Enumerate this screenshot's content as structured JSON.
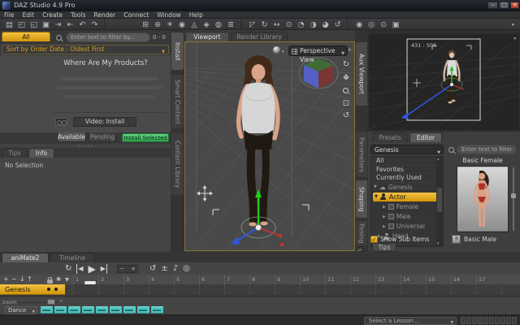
{
  "window": {
    "title": "DAZ Studio 4.9 Pro",
    "minimize": "–",
    "maximize": "□",
    "close": "×"
  },
  "menu": {
    "items": [
      "File",
      "Edit",
      "Create",
      "Tools",
      "Render",
      "Connect",
      "Window",
      "Help"
    ]
  },
  "toolbar": {
    "file_icons": [
      "▤",
      "◰",
      "◱",
      "▣",
      "⇥",
      "⇤",
      "↶",
      "↷"
    ],
    "create_icons": [
      "⊞",
      "⊕",
      "☀",
      "◉",
      "◬",
      "◈",
      "◍",
      "≣"
    ],
    "tool_icons": [
      "◸",
      "↻",
      "↔",
      "⊙",
      "◔",
      "◑",
      "◕",
      "↺"
    ],
    "camera_icons": [
      "◉",
      "◎",
      "⊙",
      "▣"
    ],
    "overflow": "▸"
  },
  "smart_content": {
    "tab_all": "All",
    "search_placeholder": "Enter text to filter by...",
    "result_count": "0 - 0",
    "sort_label": "Sort by Order Date : Oldest First",
    "heading": "Where Are My Products?",
    "video_button": "Video: Install",
    "tab_available": "Available",
    "tab_pending": "Pending",
    "install_button": "Install Selected",
    "side_tabs": {
      "install": "Install",
      "smart_content": "Smart Content",
      "content_library": "Content Library"
    },
    "tab_tips": "Tips",
    "tab_info": "Info",
    "info_text": "No Selection"
  },
  "viewport": {
    "tab_viewport": "Viewport",
    "tab_render_library": "Render Library",
    "camera_selector": "Perspective View"
  },
  "aux_viewport": {
    "tab": "Aux Viewport",
    "render_size": "431 : 505"
  },
  "scene_panel": {
    "tab_presets": "Presets",
    "tab_editor": "Editor",
    "figure_selector": "Genesis",
    "filters": [
      "All",
      "Favorites",
      "Currently Used"
    ],
    "tree": {
      "root": "Genesis",
      "actor": "Actor",
      "actor_children": [
        "Female",
        "Male",
        "Universal"
      ],
      "head": "Head"
    },
    "show_sub_items": "Show Sub Items",
    "search_placeholder": "Enter text to filter by...",
    "thumb_female": "Basic Female",
    "thumb_male": "Basic Male",
    "side_tabs": {
      "parameters": "Parameters",
      "shaping": "Shaping",
      "posing": "Posing"
    },
    "tab_tips": "Tips"
  },
  "animate": {
    "tab_animate": "aniMate2",
    "tab_timeline": "Timeline",
    "ruler": [
      "1",
      "2",
      "3",
      "4",
      "5",
      "6",
      "7",
      "8",
      "9",
      "10",
      "11",
      "12",
      "13",
      "14",
      "15",
      "16",
      "17"
    ],
    "track_label": "Genesis",
    "zoom_label": "zoom",
    "clip_group": "Dance",
    "clips": [
      "",
      "",
      "",
      "",
      "",
      "",
      "",
      "",
      ""
    ]
  },
  "lesson_bar": {
    "dropdown": "Select a Lesson...",
    "buttons": [
      "",
      "",
      "",
      "",
      "",
      "",
      "",
      "",
      "",
      ""
    ]
  },
  "icons": {
    "caret_down": "▼",
    "caret_right": "▶",
    "loop": "↻",
    "skip_back": "◀",
    "play": "▶",
    "skip_forward": "▶",
    "minus": "−",
    "plus": "+",
    "sync": "↺",
    "plus_minus": "±",
    "audio": "♪",
    "record": "◎",
    "arrow_down": "↓",
    "arrow_up": "↑",
    "gear": "✱",
    "filter": "▼",
    "orbit": "↻",
    "pan_h": "↔",
    "pan_v": "↕",
    "frame": "⊡",
    "reset": "↺",
    "check": "✓",
    "cloud": "☁",
    "expand_open": "▼",
    "expand_closed": "▶",
    "scroll_up": "▴",
    "scroll_down": "▾",
    "sphere_caret": "▾",
    "pin": "▸"
  },
  "colors": {
    "accent": "#e9b424",
    "green": "#46c06a",
    "teal": "#4ec5c1",
    "viewport_border": "#8a7434"
  }
}
